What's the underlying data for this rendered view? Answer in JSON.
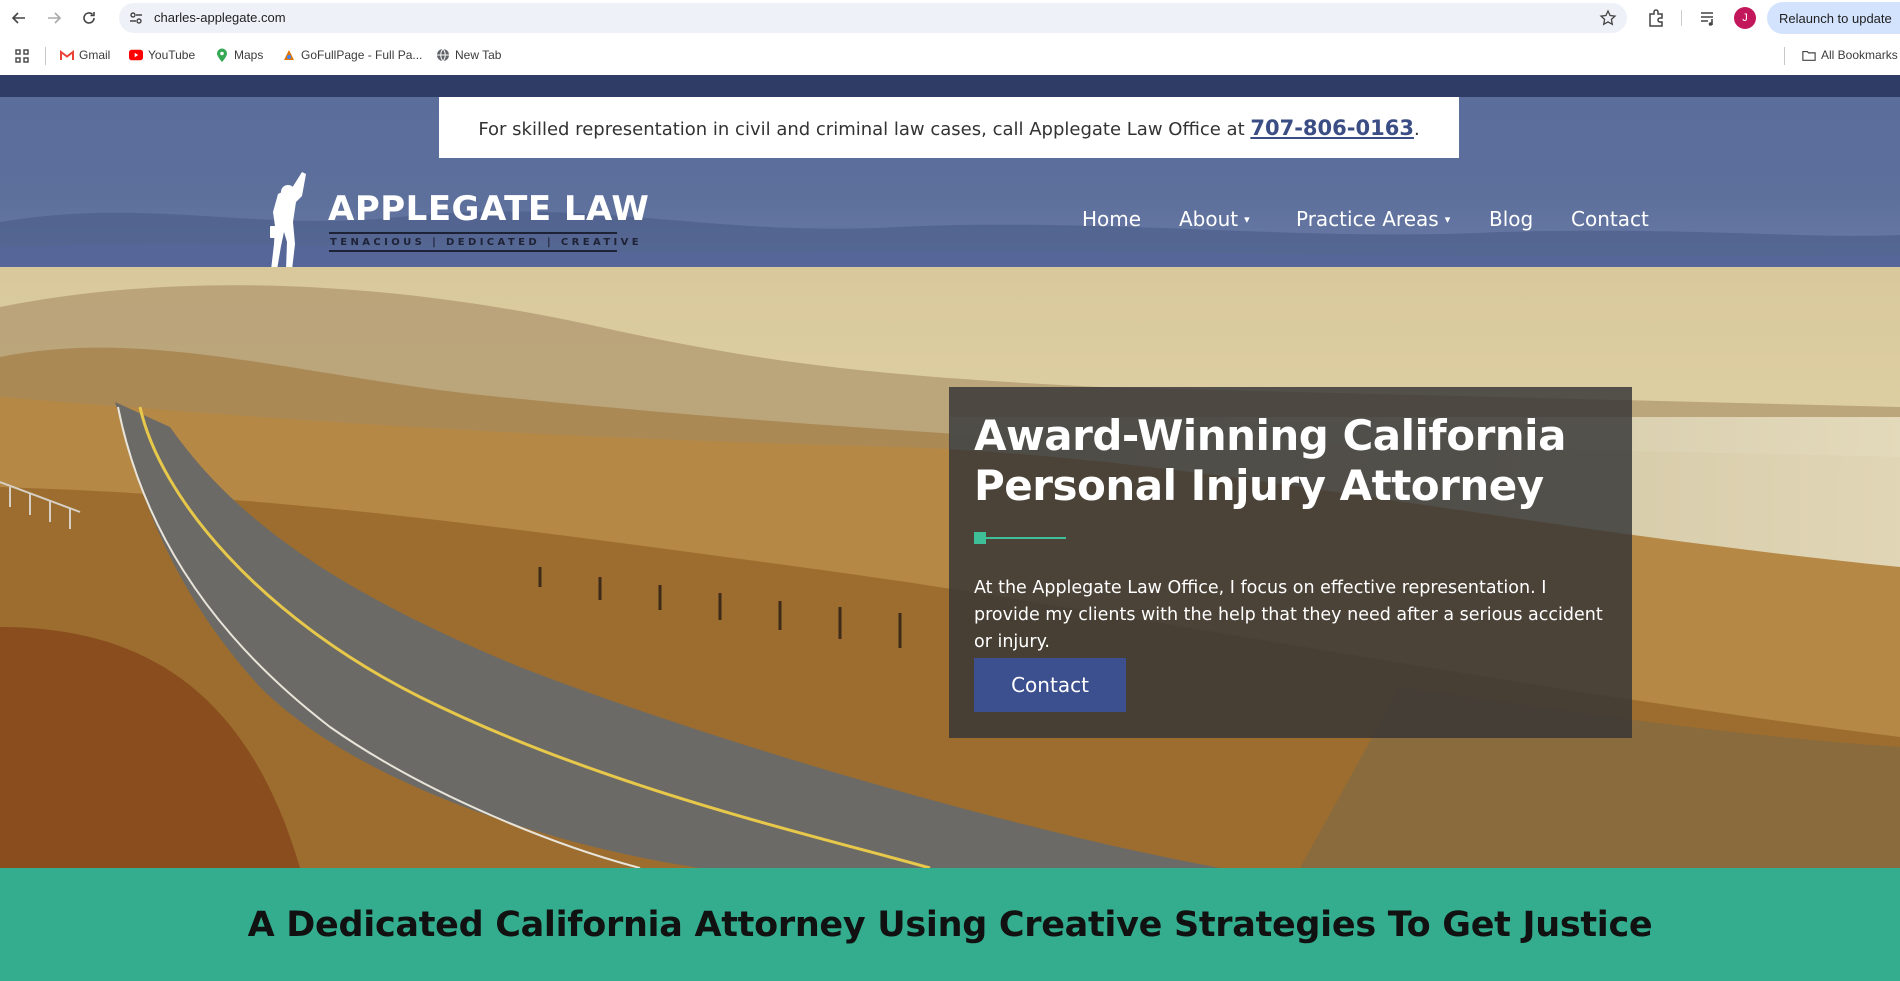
{
  "browser": {
    "url": "charles-applegate.com",
    "relaunch_label": "Relaunch to update",
    "avatar_initial": "J",
    "bookmarks": [
      {
        "label": "Gmail",
        "icon": "gmail-icon"
      },
      {
        "label": "YouTube",
        "icon": "youtube-icon"
      },
      {
        "label": "Maps",
        "icon": "maps-icon"
      },
      {
        "label": "GoFullPage - Full Pa...",
        "icon": "gofullpage-icon"
      },
      {
        "label": "New Tab",
        "icon": "globe-icon"
      }
    ],
    "all_bookmarks_label": "All Bookmarks"
  },
  "site": {
    "callbar": {
      "text": "For skilled representation in civil and criminal law cases, call Applegate Law Office at",
      "phone": "707-806-0163",
      "suffix": "."
    },
    "logo": {
      "name": "APPLEGATE LAW",
      "tagline": "TENACIOUS | DEDICATED | CREATIVE"
    },
    "nav": {
      "home": "Home",
      "about": "About",
      "practice_areas": "Practice Areas",
      "blog": "Blog",
      "contact": "Contact"
    },
    "hero": {
      "title": "Award-Winning California Personal Injury Attorney",
      "text": "At the Applegate Law Office, I focus on effective representation. I provide my clients with the help that they need after a serious accident or injury.",
      "button": "Contact"
    },
    "band_heading": "A Dedicated California Attorney Using Creative Strategies To Get Justice"
  },
  "colors": {
    "header": "#5b6d9b",
    "accent_green": "#34ad8e",
    "button_blue": "#3c4f8e",
    "phone_blue": "#3a4d84"
  }
}
